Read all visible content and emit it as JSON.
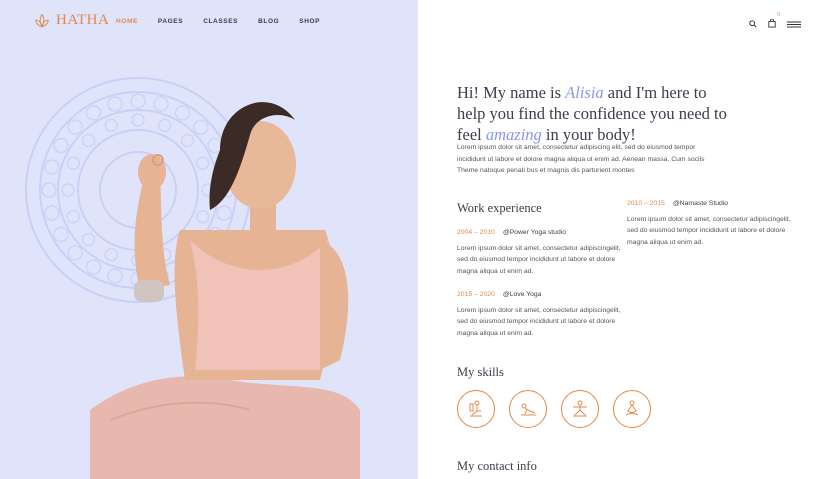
{
  "brand": {
    "name": "HATHA",
    "logo_icon": "lotus-icon",
    "accent": "#e2894a"
  },
  "nav": {
    "items": [
      {
        "label": "HOME",
        "active": true
      },
      {
        "label": "PAGES",
        "active": false
      },
      {
        "label": "CLASSES",
        "active": false
      },
      {
        "label": "BLOG",
        "active": false
      },
      {
        "label": "SHOP",
        "active": false
      }
    ]
  },
  "header": {
    "cart_count": "0",
    "search_icon": "search-icon",
    "cart_icon": "bag-icon",
    "menu_icon": "hamburger-icon"
  },
  "intro": {
    "part1": "Hi! My name is ",
    "name": "Alisia",
    "part2": " and I'm here to help you find the confidence you need to feel ",
    "highlight": "amazing",
    "part3": " in your body!",
    "description": "Lorem ipsum dolor sit amet, consectetur adipiscing elit, sed do eiusmod tempor incididunt ut labore et dolore magna aliqua ut enim ad. Aenean massa. Cum sociis Theme natoque penati bus et magnis dis parturient montes"
  },
  "work": {
    "title": "Work experience",
    "items": [
      {
        "years": "2004 – 2010",
        "place": "@Power Yoga studio",
        "text": "Lorem ipsum dolor sit amet, consectetur adipiscingelit, sed do eiusmod tempor incididunt ut labore et dolore magna aliqua ut enim ad."
      },
      {
        "years": "2015 – 2020",
        "place": "@Love Yoga",
        "text": "Lorem ipsum dolor sit amet, consectetur adipiscingelit, sed do eiusmod tempor incididunt ut labore et dolore magna aliqua ut enim ad."
      },
      {
        "years": "2010 – 2015",
        "place": "@Namaste Studio",
        "text": "Lorem ipsum dolor sit amet, consectetur adipiscingelit, sed do eiusmod tempor incididunt ut labore et dolore magna aliqua ut enim ad."
      }
    ]
  },
  "skills": {
    "title": "My skills",
    "icons": [
      "yoga-pose-seated-icon",
      "yoga-pose-stretch-icon",
      "yoga-pose-warrior-icon",
      "yoga-pose-meditation-icon"
    ]
  },
  "contact": {
    "title": "My contact info"
  }
}
